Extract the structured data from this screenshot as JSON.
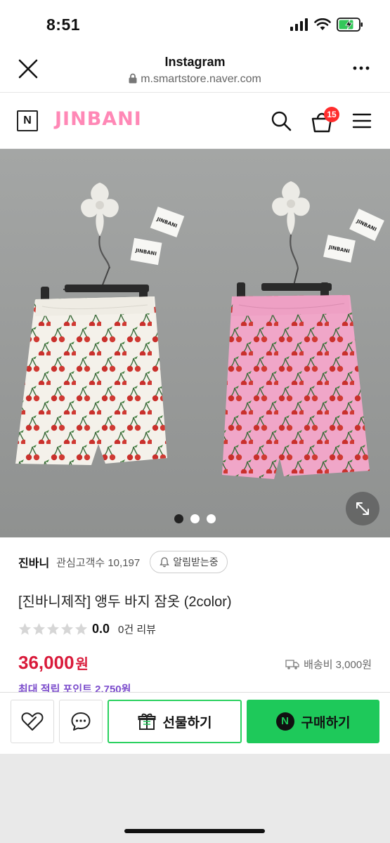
{
  "status_bar": {
    "time": "8:51"
  },
  "browser": {
    "title": "Instagram",
    "url": "m.smartstore.naver.com",
    "icons": [
      "close-icon",
      "lock-icon",
      "more-icon"
    ]
  },
  "store_header": {
    "naver_mark": "N",
    "brand": "JINBANI",
    "cart_count": "15",
    "icons": [
      "search-icon",
      "cart-icon",
      "menu-icon"
    ]
  },
  "product_image": {
    "tag_text": "JINBANI",
    "slides_total": 3,
    "active_slide": 1
  },
  "seller": {
    "name": "진바니",
    "interest_label": "관심고객수 10,197",
    "notify_label": "알림받는중"
  },
  "product": {
    "title": "[진바니제작] 앵두 바지 잠옷 (2color)",
    "rating": "0.0",
    "reviews": "0건 리뷰",
    "price": "36,000",
    "price_unit": "원",
    "shipping": "배송비 3,000원",
    "points": "최대 적립 포인트 2,750원"
  },
  "bottom_bar": {
    "gift_label": "선물하기",
    "buy_label": "구매하기",
    "buy_mark": "N"
  },
  "colors": {
    "brand_pink": "#ff88b6",
    "price_red": "#d91a3a",
    "naver_green": "#1ec95a",
    "badge_red": "#ff2d2d",
    "white_shorts": "#f4f1ea",
    "pink_shorts": "#f0a6c8",
    "cherry": "#c9302c"
  }
}
